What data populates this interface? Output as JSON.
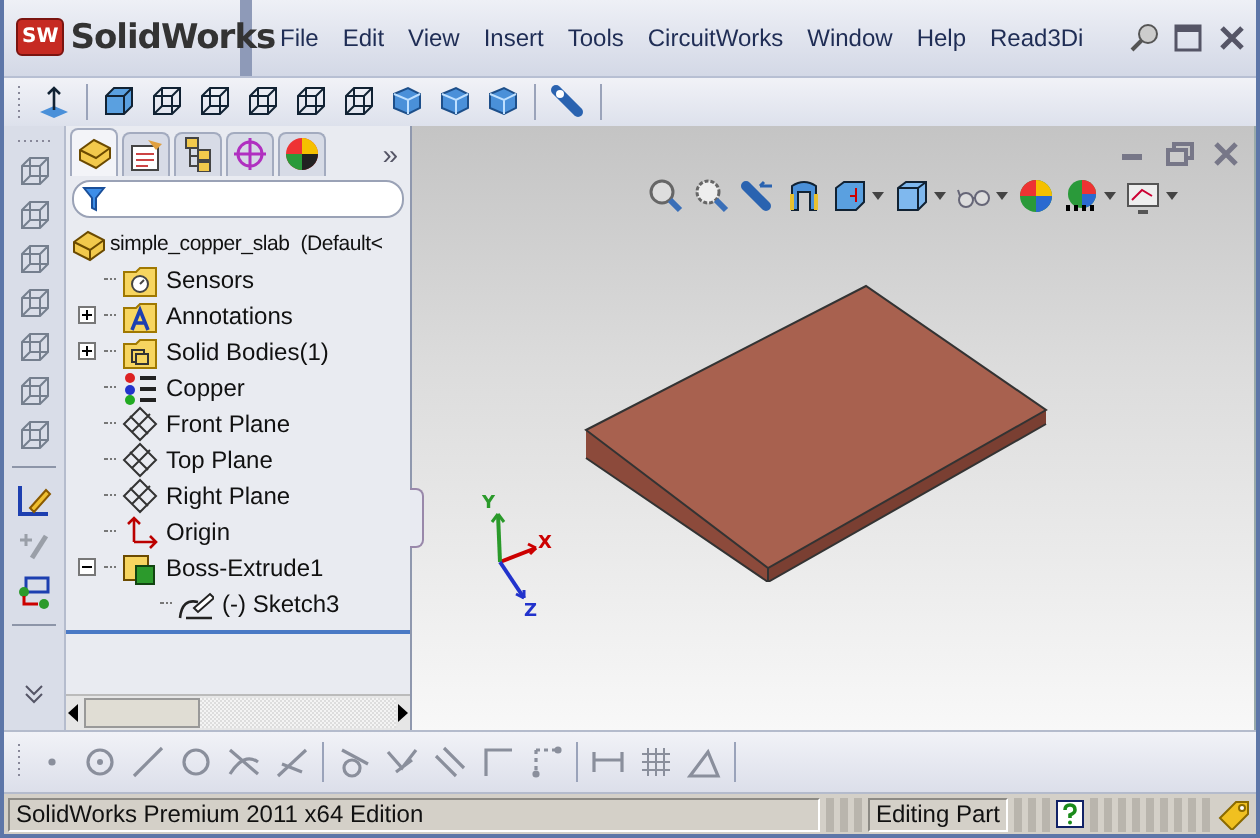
{
  "app": {
    "logo_badge": "SW",
    "logo_text": "SolidWorks"
  },
  "menu": [
    "File",
    "Edit",
    "View",
    "Insert",
    "Tools",
    "CircuitWorks",
    "Window",
    "Help",
    "Read3Di"
  ],
  "panel": {
    "tabs": [
      {
        "kind": "feature-tree",
        "selected": true
      },
      {
        "kind": "properties",
        "selected": false
      },
      {
        "kind": "configurations",
        "selected": false
      },
      {
        "kind": "dimxpert",
        "selected": false
      },
      {
        "kind": "appearance",
        "selected": false
      }
    ],
    "more_tabs": "»",
    "tree": {
      "label": "simple_copper_slab  (Default<",
      "kind": "part",
      "children": [
        {
          "label": "Sensors",
          "kind": "sensors"
        },
        {
          "label": "Annotations",
          "kind": "annotations",
          "expanded": false
        },
        {
          "label": "Solid Bodies(1)",
          "kind": "bodies",
          "expanded": false
        },
        {
          "label": "Copper",
          "kind": "material"
        },
        {
          "label": "Front Plane",
          "kind": "plane"
        },
        {
          "label": "Top Plane",
          "kind": "plane"
        },
        {
          "label": "Right Plane",
          "kind": "plane"
        },
        {
          "label": "Origin",
          "kind": "origin"
        },
        {
          "label": "Boss-Extrude1",
          "kind": "feature",
          "expanded": true,
          "children": [
            {
              "label": "(-) Sketch3",
              "kind": "sketch"
            }
          ]
        }
      ]
    }
  },
  "viewport": {
    "triad": {
      "x": "X",
      "y": "Y",
      "z": "Z"
    }
  },
  "status_bar": {
    "edition": "SolidWorks Premium 2011 x64 Edition",
    "mode": "Editing Part"
  }
}
